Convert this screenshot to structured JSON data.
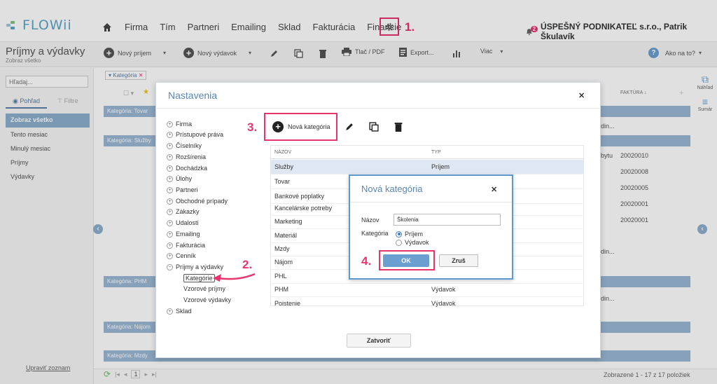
{
  "app": {
    "name": "FLOWii"
  },
  "nav": {
    "items": [
      "Firma",
      "Tím",
      "Partneri",
      "Emailing",
      "Sklad",
      "Fakturácia",
      "Financie"
    ]
  },
  "company": {
    "label": "ÚSPEŠNÝ PODNIKATEĽ s.r.o., Patrik Škulavík",
    "badge": "2"
  },
  "callouts": {
    "one": "1.",
    "two": "2.",
    "three": "3.",
    "four": "4."
  },
  "page": {
    "title": "Príjmy a výdavky",
    "subtitle": "Zobraz všetko"
  },
  "toolbar": {
    "new_income": "Nový príjem",
    "new_expense": "Nový výdavok",
    "print": "Tlač / PDF",
    "export": "Export...",
    "more": "Viac",
    "help": "Ako na to?"
  },
  "left": {
    "search_placeholder": "Hľadaj...",
    "tab_view": "Pohľad",
    "tab_filter": "Filtre",
    "items": [
      "Zobraz všetko",
      "Tento mesiac",
      "Minulý mesiac",
      "Príjmy",
      "Výdavky"
    ],
    "edit_list": "Upraviť zoznam"
  },
  "list": {
    "filter_chip": "Kategória",
    "faktura_header": "FAKTÚRA",
    "groups": [
      "Kategória: Tovar",
      "Kategória: Služby",
      "Kategória: PHM",
      "Kategória: Nájom",
      "Kategória: Mzdy"
    ],
    "faktura_values": [
      "20020010",
      "20020008",
      "20020005",
      "20020001",
      "20020001"
    ],
    "partial_texts": [
      "din...",
      "bytu",
      "din...",
      "din..."
    ],
    "footer_count": "Zobrazené 1 - 17 z 17 položiek",
    "page_number": "1"
  },
  "rightside": {
    "preview": "Náhľad",
    "summary": "Sumár"
  },
  "settings": {
    "title": "Nastavenia",
    "tree": [
      "Firma",
      "Prístupové práva",
      "Číselníky",
      "Rozšírenia",
      "Dochádzka",
      "Úlohy",
      "Partneri",
      "Obchodné prípady",
      "Zákazky",
      "Udalosti",
      "Emailing",
      "Fakturácia",
      "Cenník",
      "Príjmy a výdavky"
    ],
    "subitems": [
      "Kategórie",
      "Vzorové príjmy",
      "Vzorové výdavky"
    ],
    "tree_last": "Sklad",
    "new_category": "Nová kategória",
    "col_name": "NÁZOV",
    "col_type": "TYP",
    "rows": [
      {
        "name": "Služby",
        "type": "Príjem"
      },
      {
        "name": "Tovar",
        "type": ""
      },
      {
        "name": "Bankové poplatky",
        "type": ""
      },
      {
        "name": "Kancelárske potreby",
        "type": ""
      },
      {
        "name": "Marketing",
        "type": ""
      },
      {
        "name": "Materiál",
        "type": ""
      },
      {
        "name": "Mzdy",
        "type": ""
      },
      {
        "name": "Nájom",
        "type": ""
      },
      {
        "name": "PHL",
        "type": ""
      },
      {
        "name": "PHM",
        "type": "Výdavok"
      },
      {
        "name": "Poistenie",
        "type": "Výdavok"
      }
    ],
    "close": "Zatvoriť"
  },
  "new_category_dialog": {
    "title": "Nová kategória",
    "name_label": "Názov",
    "name_value": "Školenia",
    "category_label": "Kategória",
    "option_income": "Príjem",
    "option_expense": "Výdavok",
    "ok": "OK",
    "cancel": "Zruš"
  },
  "colors": {
    "accent": "#5a86b5",
    "highlight": "#e8336d",
    "group_row": "#9bb8d4"
  }
}
